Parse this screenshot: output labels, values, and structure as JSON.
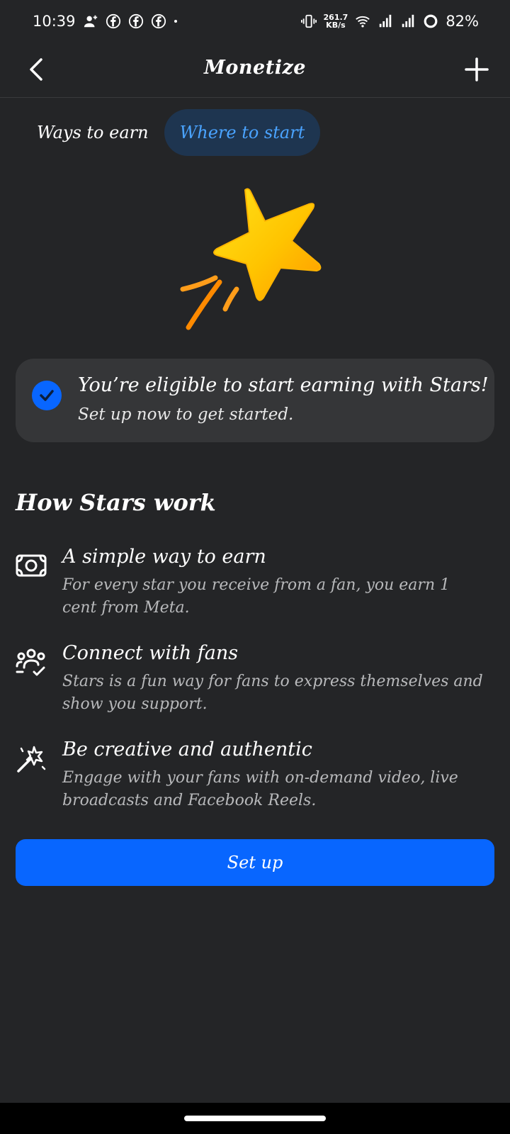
{
  "status_bar": {
    "time": "10:39",
    "net_speed_value": "261.7",
    "net_speed_unit": "KB/s",
    "battery": "82%",
    "icons": [
      "person-add-icon",
      "facebook-icon",
      "facebook-icon",
      "facebook-icon",
      "dot-icon",
      "vibrate-icon",
      "wifi-icon",
      "signal-icon",
      "signal-icon",
      "battery-ring-icon"
    ]
  },
  "header": {
    "title": "Monetize",
    "back_icon": "chevron-left-icon",
    "add_icon": "plus-icon"
  },
  "tabs": [
    {
      "label": "Ways to earn",
      "active": false
    },
    {
      "label": "Where to start",
      "active": true
    }
  ],
  "eligibility": {
    "title": "You’re eligible to start earning with Stars!",
    "subtitle": "Set up now to get started."
  },
  "section": {
    "title": "How Stars work"
  },
  "features": [
    {
      "icon": "money-icon",
      "title": "A simple way to earn",
      "description": "For every star you receive from a fan, you earn 1 cent from Meta."
    },
    {
      "icon": "people-check-icon",
      "title": "Connect with fans",
      "description": "Stars is a fun way for fans to express themselves and show you support."
    },
    {
      "icon": "magic-wand-icon",
      "title": "Be creative and authentic",
      "description": "Engage with your fans with on-demand video, live broadcasts and Facebook Reels."
    }
  ],
  "setup_button": {
    "label": "Set up"
  },
  "colors": {
    "background": "#242527",
    "card": "#353638",
    "accent": "#0866ff",
    "active_tab_bg": "#1e3550",
    "active_tab_text": "#4aa3ff"
  }
}
